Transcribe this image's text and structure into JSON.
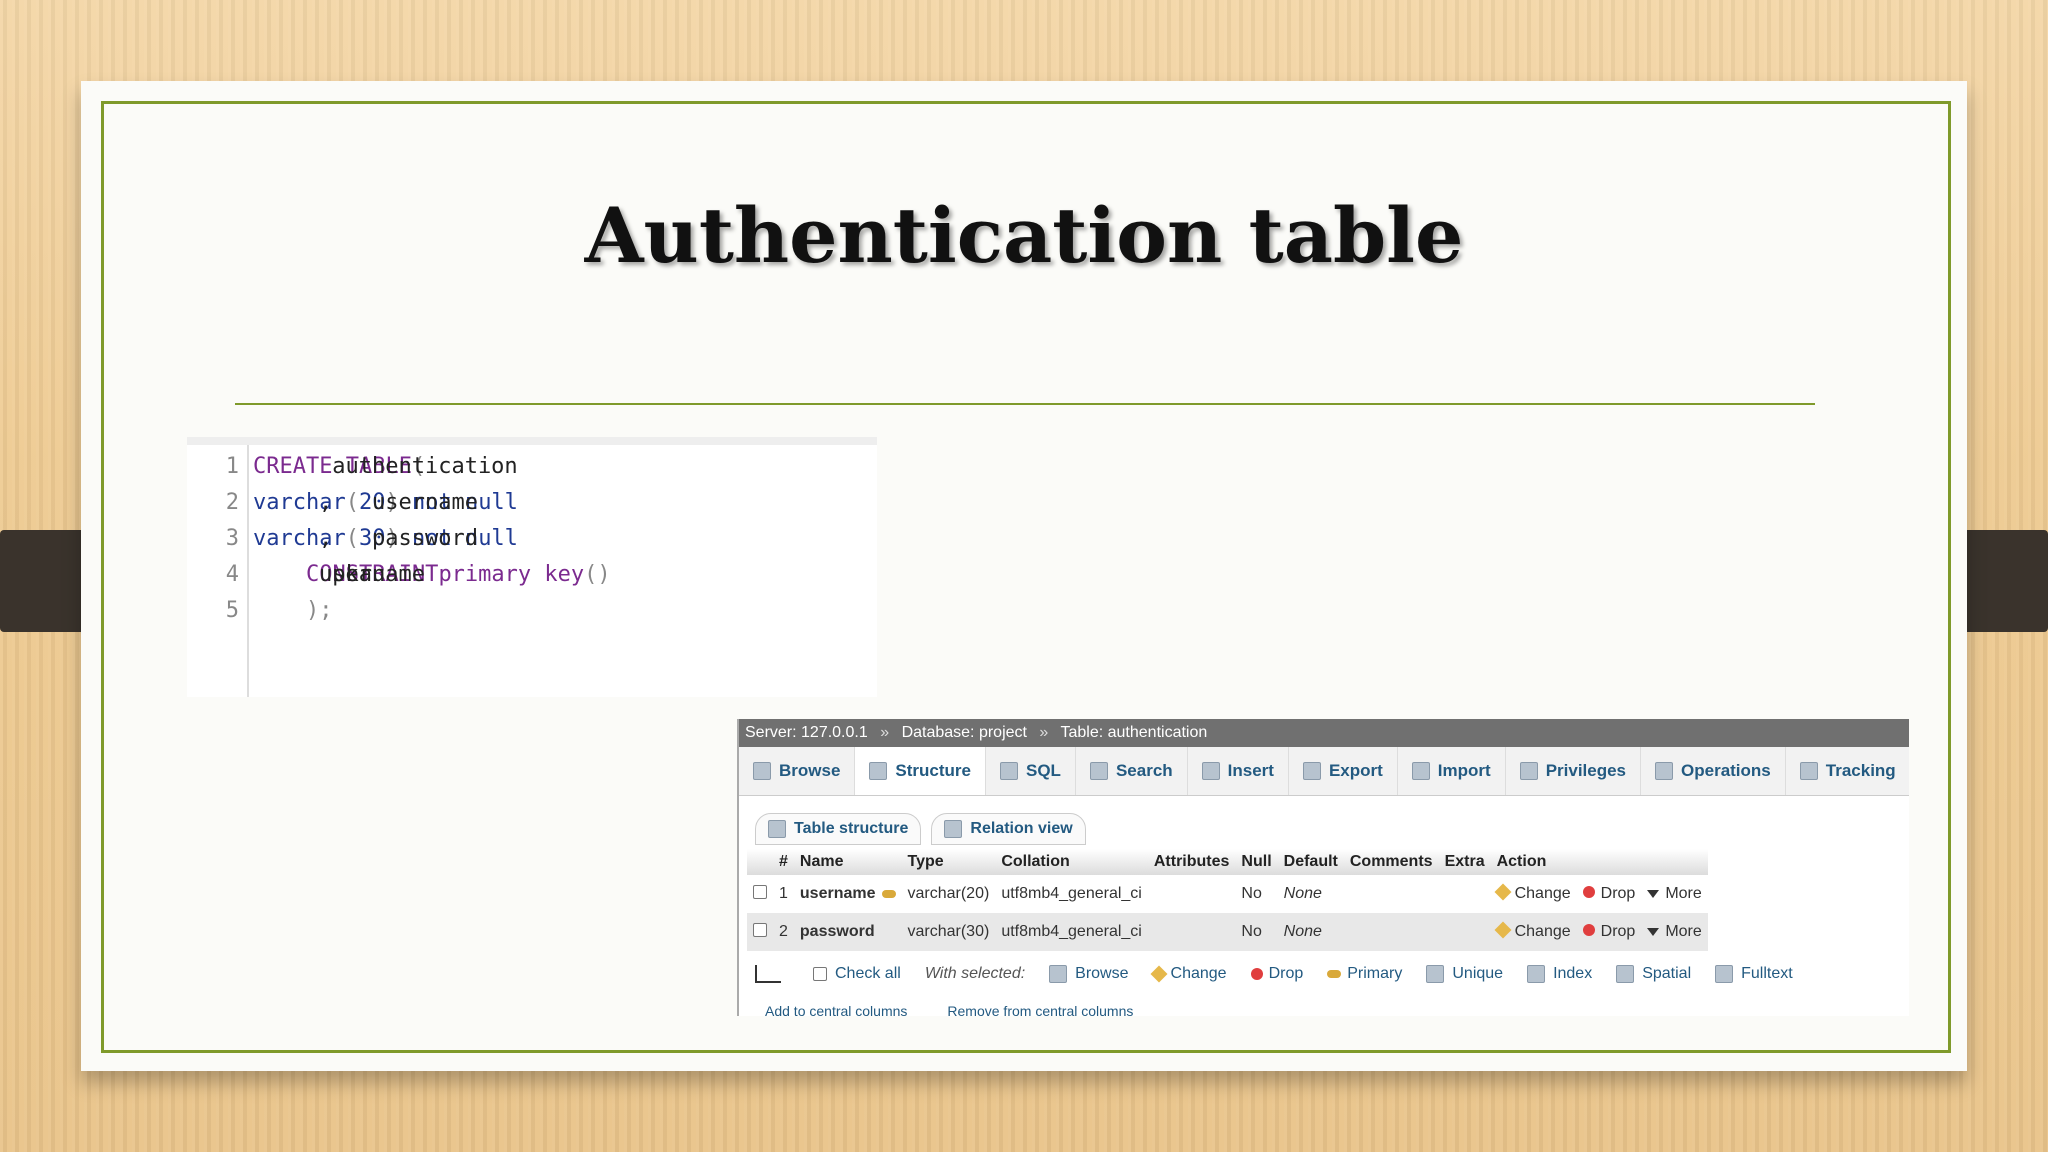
{
  "slide": {
    "title": "Authentication table"
  },
  "code": {
    "lines": [
      {
        "n": "1",
        "parts": [
          [
            "kw",
            "CREATE TABLE"
          ],
          [
            "src",
            " authentication  "
          ],
          [
            "pn",
            "("
          ]
        ]
      },
      {
        "n": "2",
        "parts": [
          [
            "src",
            "    username "
          ],
          [
            "fn",
            "varchar"
          ],
          [
            "pn",
            "("
          ],
          [
            "fn",
            "20"
          ],
          [
            "pn",
            ")"
          ],
          [
            "fn",
            " not null"
          ],
          [
            "src",
            ","
          ]
        ]
      },
      {
        "n": "3",
        "parts": [
          [
            "src",
            "    password "
          ],
          [
            "fn",
            "varchar"
          ],
          [
            "pn",
            "("
          ],
          [
            "fn",
            "30"
          ],
          [
            "pn",
            ")"
          ],
          [
            "fn",
            " not null"
          ],
          [
            "src",
            ","
          ]
        ]
      },
      {
        "n": "4",
        "parts": [
          [
            "kw",
            "    CONSTRAINT"
          ],
          [
            "src",
            " pkau "
          ],
          [
            "kw",
            "primary key"
          ],
          [
            "src",
            " "
          ],
          [
            "pn",
            "("
          ],
          [
            "src",
            "username"
          ],
          [
            "pn",
            ")"
          ]
        ]
      },
      {
        "n": "5",
        "parts": [
          [
            "pn",
            "    );"
          ]
        ]
      }
    ]
  },
  "pma": {
    "breadcrumb": {
      "server": "Server: 127.0.0.1",
      "database": "Database: project",
      "table": "Table: authentication",
      "sep": "»"
    },
    "tabs": [
      "Browse",
      "Structure",
      "SQL",
      "Search",
      "Insert",
      "Export",
      "Import",
      "Privileges",
      "Operations",
      "Tracking"
    ],
    "subtabs": [
      "Table structure",
      "Relation view"
    ],
    "columns": [
      "#",
      "Name",
      "Type",
      "Collation",
      "Attributes",
      "Null",
      "Default",
      "Comments",
      "Extra",
      "Action"
    ],
    "rows": [
      {
        "num": "1",
        "name": "username",
        "type": "varchar(20)",
        "collation": "utf8mb4_general_ci",
        "attributes": "",
        "null": "No",
        "default": "None",
        "comments": "",
        "extra": ""
      },
      {
        "num": "2",
        "name": "password",
        "type": "varchar(30)",
        "collation": "utf8mb4_general_ci",
        "attributes": "",
        "null": "No",
        "default": "None",
        "comments": "",
        "extra": ""
      }
    ],
    "row_actions": {
      "change": "Change",
      "drop": "Drop",
      "more": "More"
    },
    "footer": {
      "check_all": "Check all",
      "with_selected": "With selected:",
      "actions": [
        "Browse",
        "Change",
        "Drop",
        "Primary",
        "Unique",
        "Index",
        "Spatial",
        "Fulltext"
      ],
      "add_central": "Add to central columns",
      "remove_central": "Remove from central columns"
    }
  }
}
